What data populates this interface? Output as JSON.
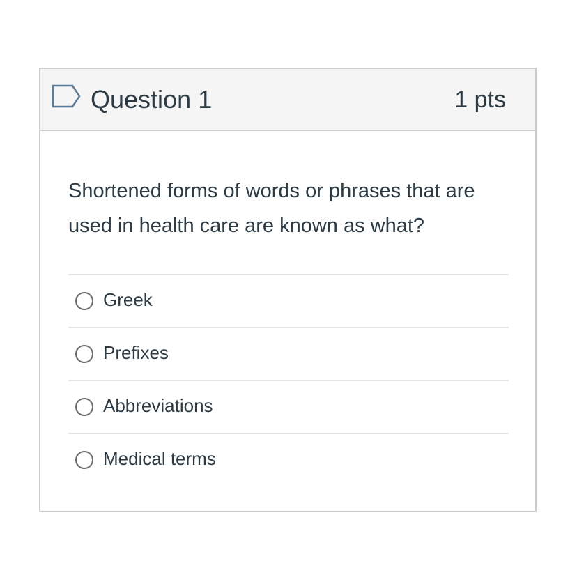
{
  "question": {
    "title": "Question 1",
    "points": "1 pts",
    "flag_icon": "flag-outline-icon",
    "text": "Shortened forms of words or phrases that are used in health care are known as what?"
  },
  "answers": [
    {
      "label": "Greek",
      "selected": false
    },
    {
      "label": "Prefixes",
      "selected": false
    },
    {
      "label": "Abbreviations",
      "selected": false
    },
    {
      "label": "Medical terms",
      "selected": false
    }
  ],
  "colors": {
    "text": "#2d3b45",
    "header_bg": "#f5f5f5",
    "border": "#c7cdd1",
    "flag": "#5b7b9a",
    "radio": "#6b6b6b"
  }
}
